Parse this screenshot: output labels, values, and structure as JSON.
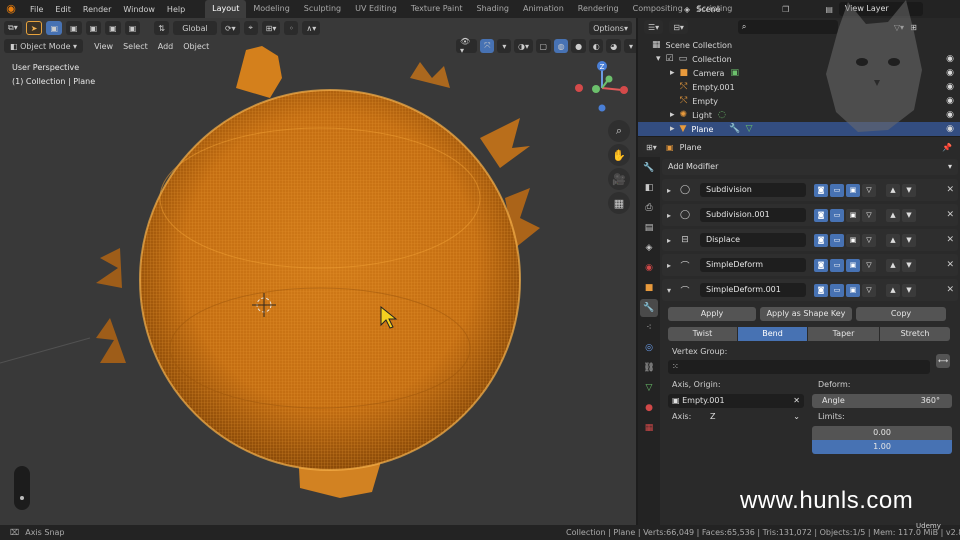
{
  "menubar": {
    "items": [
      "File",
      "Edit",
      "Render",
      "Window",
      "Help"
    ],
    "workspaces": [
      "Layout",
      "Modeling",
      "Sculpting",
      "UV Editing",
      "Texture Paint",
      "Shading",
      "Animation",
      "Rendering",
      "Compositing",
      "Scripting"
    ],
    "active_workspace": "Layout",
    "scene": "Scene",
    "view_layer": "View Layer"
  },
  "viewport": {
    "transform_orientation": "Global",
    "options_label": "Options",
    "mode": "Object Mode",
    "menus": [
      "View",
      "Select",
      "Add",
      "Object"
    ],
    "info_line1": "User Perspective",
    "info_line2": "(1) Collection | Plane",
    "mesh_color": "#f0a030",
    "background_color": "#393939"
  },
  "outliner": {
    "root": "Scene Collection",
    "collection": "Collection",
    "items": [
      {
        "name": "Camera",
        "icon": "camera-icon"
      },
      {
        "name": "Empty.001",
        "icon": "empty-icon"
      },
      {
        "name": "Empty",
        "icon": "empty-icon"
      },
      {
        "name": "Light",
        "icon": "light-icon"
      },
      {
        "name": "Plane",
        "icon": "mesh-icon",
        "selected": true
      }
    ]
  },
  "properties": {
    "object_name": "Plane",
    "add_modifier": "Add Modifier",
    "modifiers": [
      {
        "name": "Subdivision",
        "icon": "subdivision-icon"
      },
      {
        "name": "Subdivision.001",
        "icon": "subdivision-icon"
      },
      {
        "name": "Displace",
        "icon": "displace-icon"
      },
      {
        "name": "SimpleDeform",
        "icon": "simpledeform-icon"
      },
      {
        "name": "SimpleDeform.001",
        "icon": "simpledeform-icon",
        "expanded": true
      }
    ],
    "apply": "Apply",
    "apply_shape_key": "Apply as Shape Key",
    "copy": "Copy",
    "deform_methods": [
      "Twist",
      "Bend",
      "Taper",
      "Stretch"
    ],
    "active_method": "Bend",
    "vertex_group_label": "Vertex Group:",
    "axis_origin_label": "Axis, Origin:",
    "origin_object": "Empty.001",
    "axis_label": "Axis:",
    "axis_value": "Z",
    "deform_label": "Deform:",
    "angle_label": "Angle",
    "angle_value": "360°",
    "limits_label": "Limits:",
    "limit_min": "0.00",
    "limit_max": "1.00"
  },
  "statusbar": {
    "left": "Axis Snap",
    "right": "Collection | Plane | Verts:66,049 | Faces:65,536 | Tris:131,072 | Objects:1/5 | Mem: 117.0 MiB | v2.81.16"
  },
  "watermark": "www.hunls.com",
  "corner_brand": "Udemy"
}
